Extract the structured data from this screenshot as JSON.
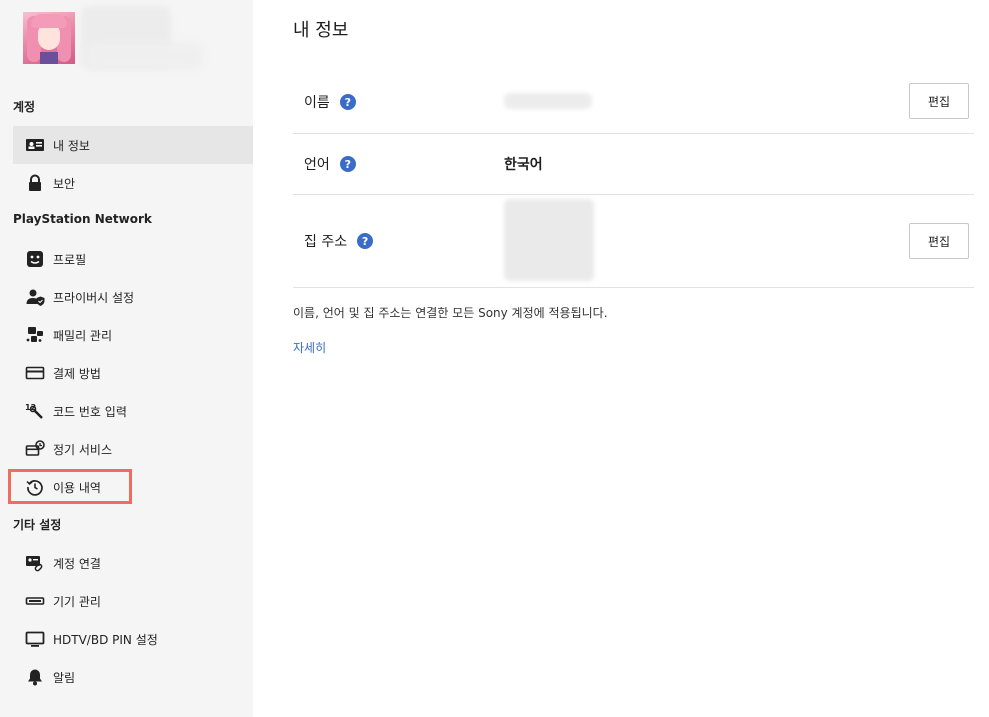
{
  "sidebar": {
    "sections": {
      "account": "계정",
      "psn": "PlayStation Network",
      "other": "기타 설정"
    },
    "items": [
      {
        "label": "내 정보",
        "icon": "id-card-icon"
      },
      {
        "label": "보안",
        "icon": "lock-icon"
      },
      {
        "label": "프로필",
        "icon": "face-icon"
      },
      {
        "label": "프라이버시 설정",
        "icon": "privacy-shield-icon"
      },
      {
        "label": "패밀리 관리",
        "icon": "family-icon"
      },
      {
        "label": "결제 방법",
        "icon": "credit-card-icon"
      },
      {
        "label": "코드 번호 입력",
        "icon": "code-entry-icon"
      },
      {
        "label": "정기 서비스",
        "icon": "subscription-icon"
      },
      {
        "label": "이용 내역",
        "icon": "history-icon"
      },
      {
        "label": "계정 연결",
        "icon": "link-account-icon"
      },
      {
        "label": "기기 관리",
        "icon": "device-icon"
      },
      {
        "label": "HDTV/BD PIN 설정",
        "icon": "monitor-icon"
      },
      {
        "label": "알림",
        "icon": "bell-icon"
      }
    ]
  },
  "main": {
    "title": "내 정보",
    "rows": [
      {
        "label": "이름",
        "value": "",
        "edit": "편집"
      },
      {
        "label": "언어",
        "value": "한국어"
      },
      {
        "label": "집 주소",
        "value": "",
        "edit": "편집"
      }
    ],
    "note": "이름, 언어 및 집 주소는 연결한 모든 Sony 계정에 적용됩니다.",
    "learn_more": "자세히"
  },
  "colors": {
    "sidebar_bg": "#f5f5f5",
    "active_item_bg": "#e6e6e6",
    "help_icon": "#3a6bc8",
    "highlight": "#f26b5f"
  }
}
